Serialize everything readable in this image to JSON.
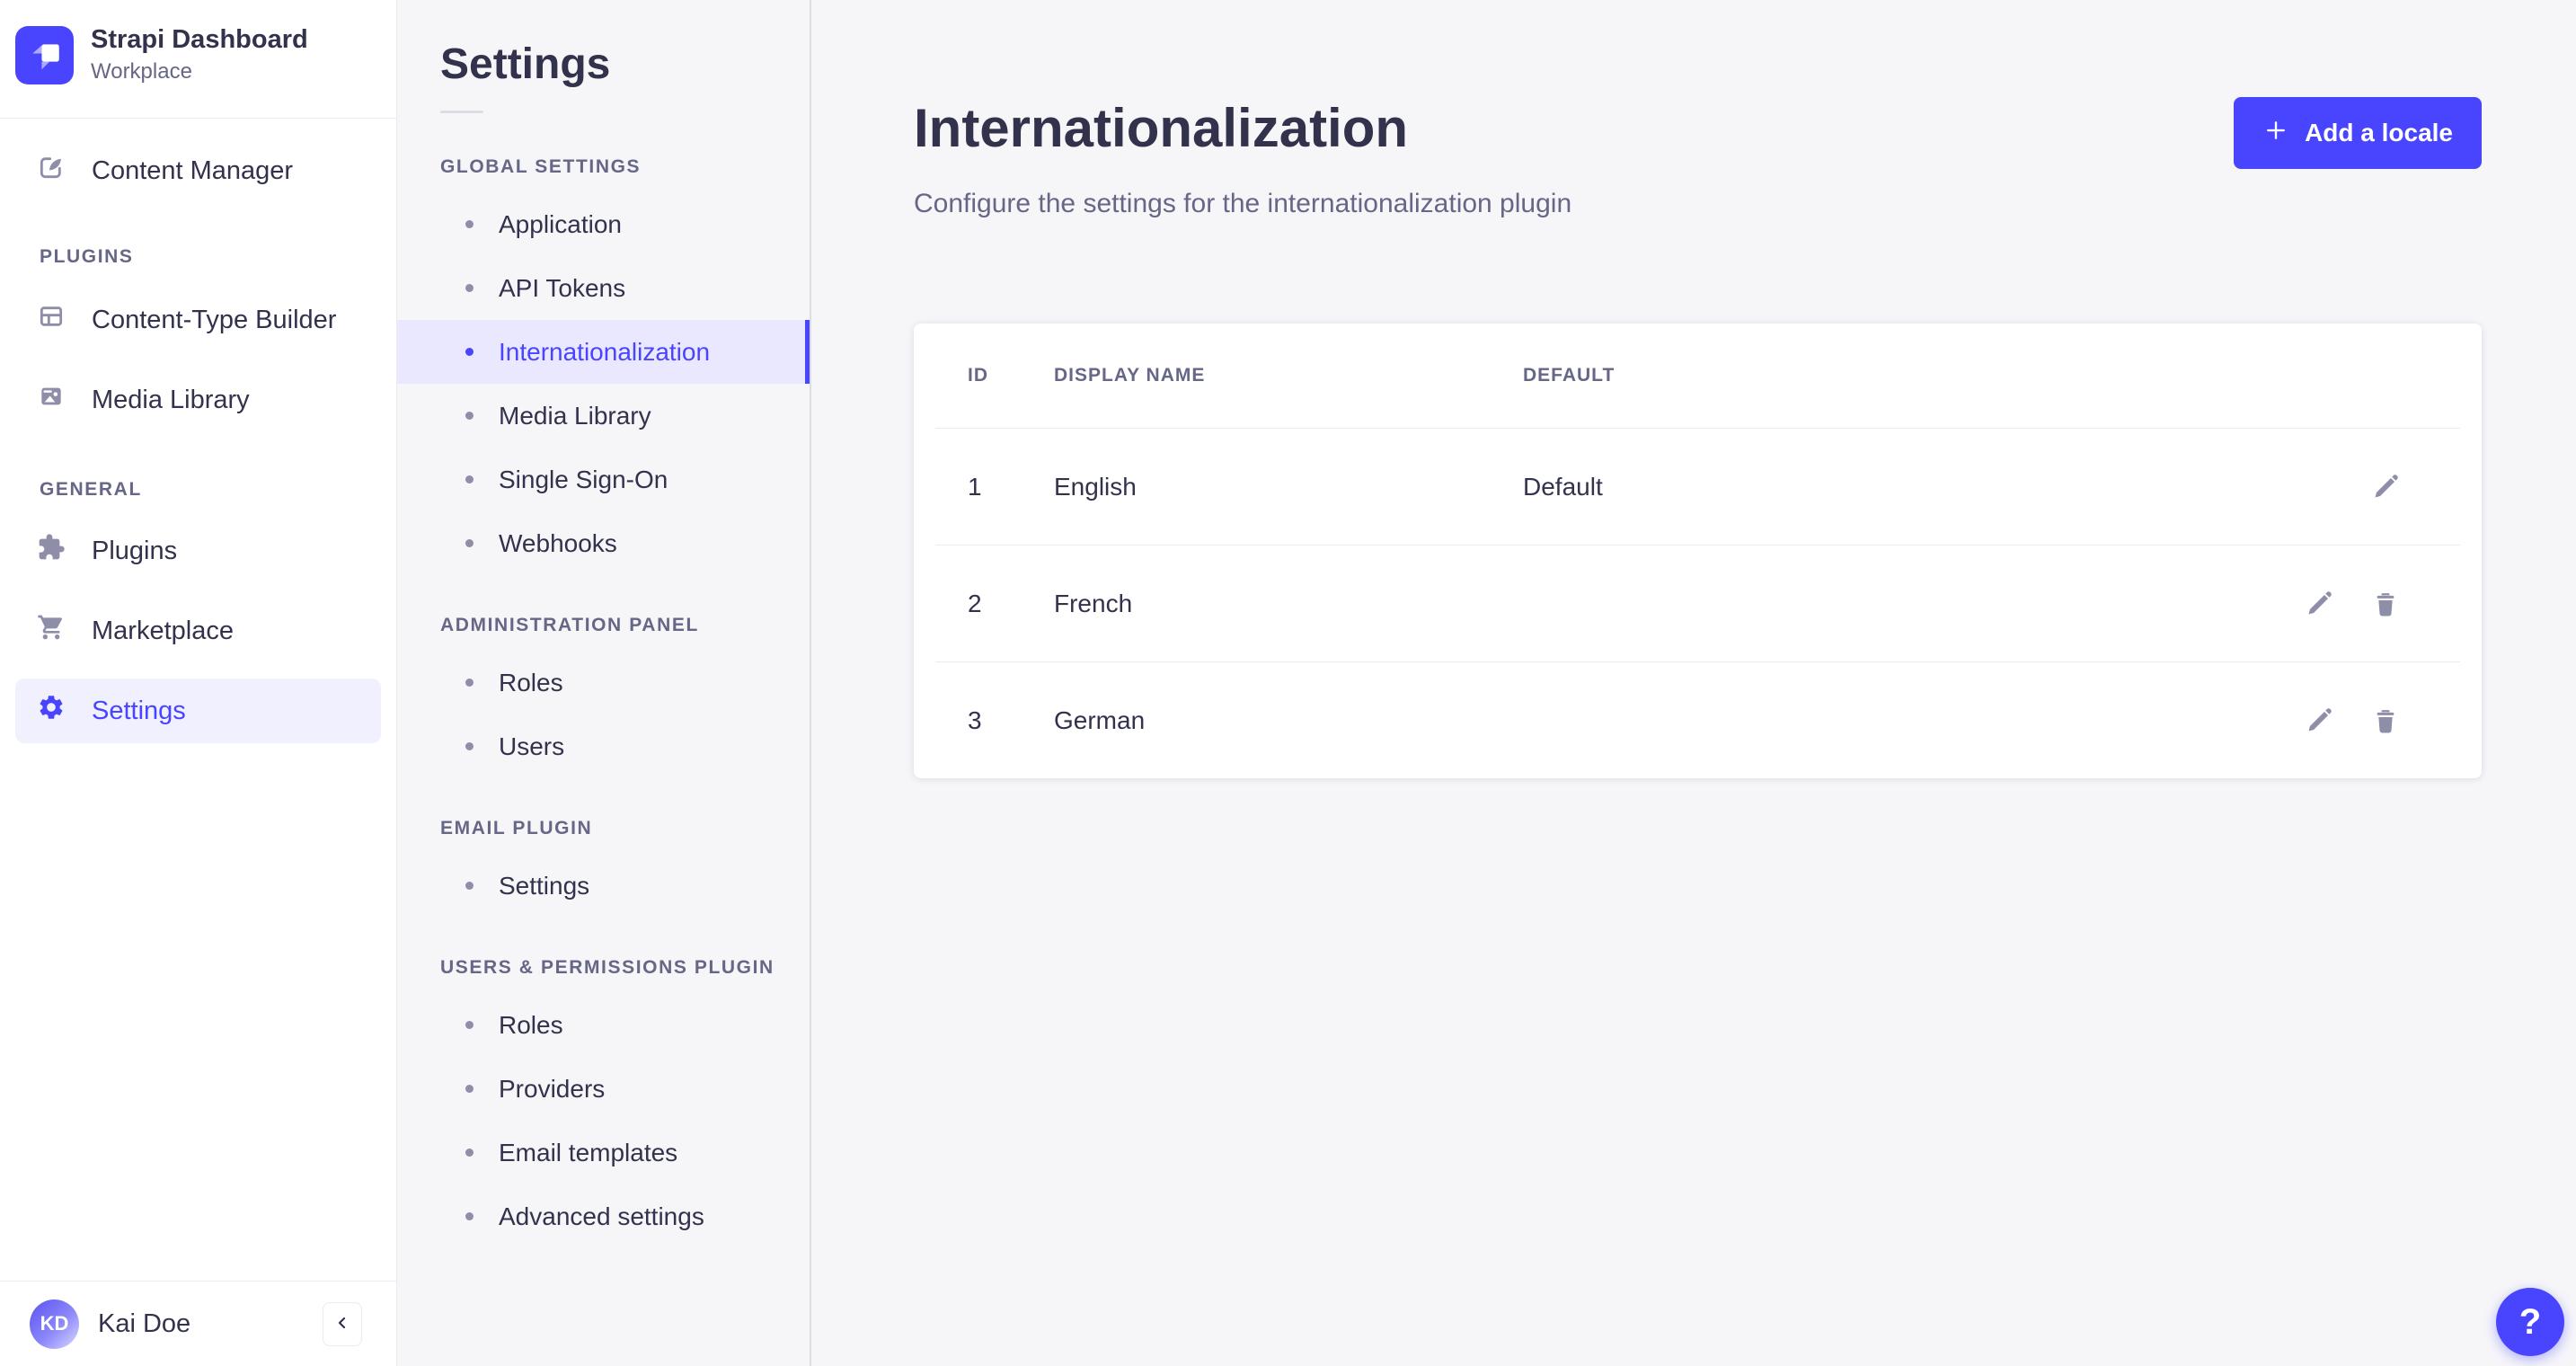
{
  "app": {
    "brand": {
      "name": "Strapi Dashboard",
      "workspace": "Workplace"
    }
  },
  "main_nav": {
    "content_manager": "Content Manager",
    "plugins_section": {
      "title": "PLUGINS",
      "content_type_builder": "Content-Type Builder",
      "media_library": "Media Library"
    },
    "general_section": {
      "title": "GENERAL",
      "plugins": "Plugins",
      "marketplace": "Marketplace",
      "settings": "Settings"
    },
    "user": {
      "initials": "KD",
      "name": "Kai Doe"
    },
    "collapse_icon": "chevron-left-icon"
  },
  "sub_nav": {
    "title": "Settings",
    "active_item": "Internationalization",
    "global_settings": {
      "title": "GLOBAL SETTINGS",
      "items": [
        "Application",
        "API Tokens",
        "Internationalization",
        "Media Library",
        "Single Sign-On",
        "Webhooks"
      ]
    },
    "administration_panel": {
      "title": "ADMINISTRATION PANEL",
      "items": [
        "Roles",
        "Users"
      ]
    },
    "email_plugin": {
      "title": "EMAIL PLUGIN",
      "items": [
        "Settings"
      ]
    },
    "users_permissions": {
      "title": "USERS & PERMISSIONS PLUGIN",
      "items": [
        "Roles",
        "Providers",
        "Email templates",
        "Advanced settings"
      ]
    }
  },
  "content": {
    "title": "Internationalization",
    "subtitle": "Configure the settings for the internationalization plugin",
    "add_locale_button": "Add a locale",
    "table": {
      "headers": {
        "id": "ID",
        "display_name": "DISPLAY NAME",
        "default": "DEFAULT"
      },
      "rows": [
        {
          "id": "1",
          "display_name": "English",
          "default": "Default",
          "deletable": false
        },
        {
          "id": "2",
          "display_name": "French",
          "default": "",
          "deletable": true
        },
        {
          "id": "3",
          "display_name": "German",
          "default": "",
          "deletable": true
        }
      ]
    }
  },
  "help": {
    "label": "?"
  },
  "icons": {
    "brand": "strapi-logo-icon",
    "content_manager": "feather-pen-icon",
    "content_type_builder": "layout-grid-icon",
    "media_library": "picture-icon",
    "plugins": "puzzle-icon",
    "marketplace": "cart-icon",
    "settings": "gear-icon",
    "add": "plus-icon",
    "edit": "pencil-icon",
    "delete": "trash-icon",
    "collapse": "chevron-left-icon",
    "help": "question-mark-icon"
  },
  "colors": {
    "primary": "#4945ff",
    "primary_light_bg": "#e9e8ff",
    "sidebar_active_bg": "#f0f0ff",
    "text_dark": "#32324d",
    "text_muted": "#666687",
    "icon_gray": "#8e8ea9",
    "border": "#eaeaef",
    "page_bg": "#f6f6f9",
    "card_bg": "#ffffff"
  }
}
